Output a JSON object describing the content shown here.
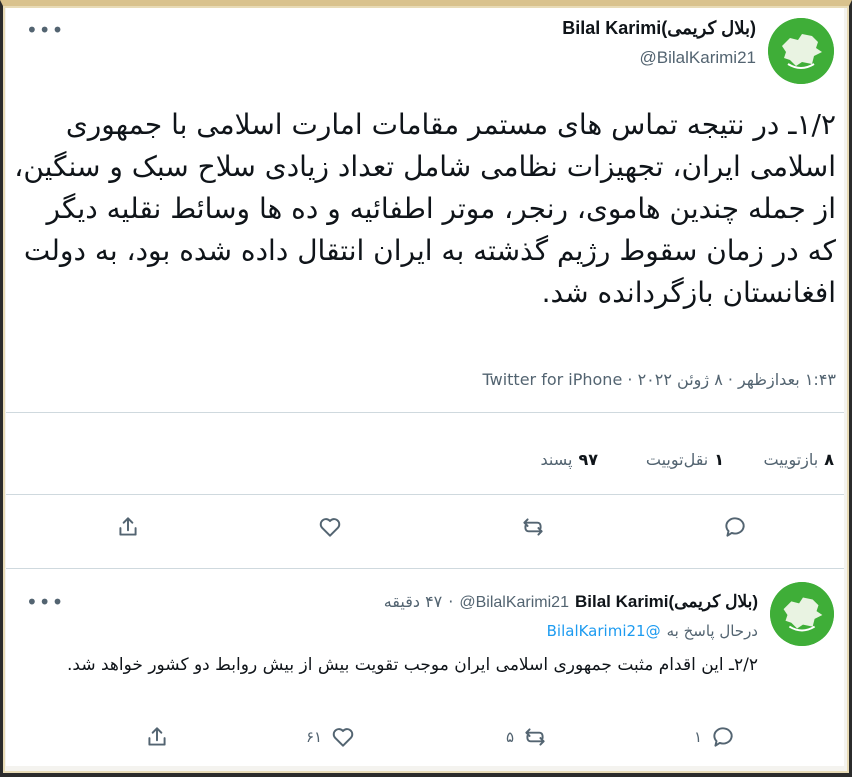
{
  "main_tweet": {
    "author_name": "Bilal Karimi(بلال کریمی)",
    "handle": "@BilalKarimi21",
    "more_icon": "more-horizontal-icon",
    "text": "۱/۲ـ در نتیجه تماس های مستمر مقامات امارت اسلامی با جمهوری اسلامی ایران، تجهیزات نظامی شامل تعداد زیادی سلاح سبک و سنگین، از جمله چندین هاموی، رنجر، موتر اطفائیه و ده ها وسائط نقلیه دیگر که در زمان سقوط رژیم گذشته به ایران انتقال داده شده بود، به دولت افغانستان بازگردانده شد.",
    "timestamp": "۱:۴۳ بعدازظهر · ۸ ژوئن ۲۰۲۲ · Twitter for iPhone",
    "stats": {
      "retweets_value": "۸",
      "retweets_label": "بازتوییت",
      "quotes_value": "۱",
      "quotes_label": "نقل‌توییت",
      "likes_value": "۹۷",
      "likes_label": "پسند"
    }
  },
  "reply_tweet": {
    "author_name": "Bilal Karimi(بلال کریمی)",
    "handle": "@BilalKarimi21",
    "time": "۴۷ دقیقه",
    "replying_prefix": "درحال پاسخ به",
    "replying_handle": "@BilalKarimi21",
    "text": "۲/۲ـ این اقدام مثبت جمهوری اسلامی ایران موجب تقویت بیش از بیش روابط دو کشور خواهد شد.",
    "counts": {
      "replies": "۱",
      "retweets": "۵",
      "likes": "۶۱"
    }
  },
  "colors": {
    "avatar_green": "#3fae38",
    "link_blue": "#1d9bf0",
    "text_primary": "#0f1419",
    "text_secondary": "#536471"
  }
}
